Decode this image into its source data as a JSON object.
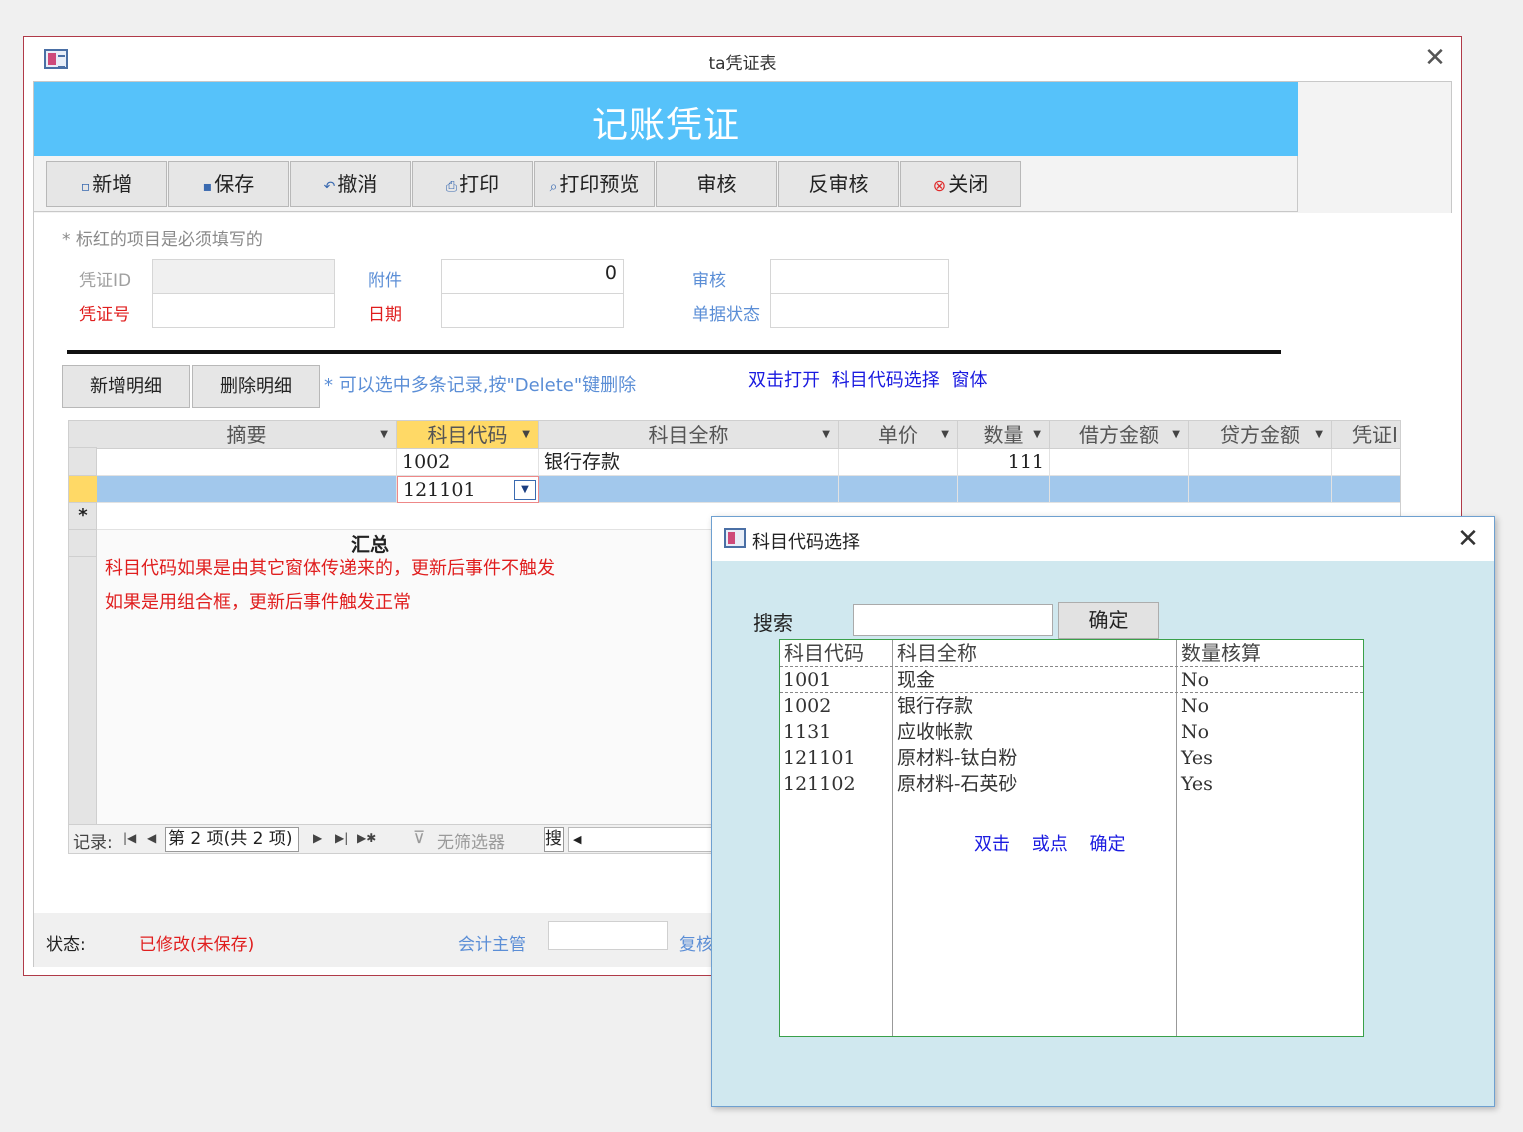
{
  "window": {
    "title": "ta凭证表"
  },
  "header": {
    "title": "记账凭证"
  },
  "toolbar": {
    "buttons": [
      {
        "label": "新增",
        "icon": "new-record-icon"
      },
      {
        "label": "保存",
        "icon": "save-disk-icon"
      },
      {
        "label": "撤消",
        "icon": "undo-arrow-icon"
      },
      {
        "label": "打印",
        "icon": "printer-icon"
      },
      {
        "label": "打印预览",
        "icon": "magnifier-icon"
      },
      {
        "label": "审核",
        "icon": ""
      },
      {
        "label": "反审核",
        "icon": ""
      },
      {
        "label": "关闭",
        "icon": "close-circle-icon"
      }
    ]
  },
  "form": {
    "required_note": "* 标红的项目是必须填写的",
    "voucher_id_label": "凭证ID",
    "voucher_no_label": "凭证号",
    "attachment_label": "附件",
    "attachment_value": "0",
    "date_label": "日期",
    "review_label": "审核",
    "doc_status_label": "单据状态"
  },
  "detail": {
    "add_button": "新增明细",
    "delete_button": "删除明细",
    "delete_note": "* 可以选中多条记录,按\"Delete\"键删除",
    "dblclick_note": "双击打开 科目代码选择 窗体"
  },
  "datasheet": {
    "columns": [
      "摘要",
      "科目代码",
      "科目全称",
      "单价",
      "数量",
      "借方金额",
      "贷方金额",
      "凭证I"
    ],
    "rows": [
      {
        "summary": "",
        "code": "1002",
        "name": "银行存款",
        "price": "",
        "qty": "111",
        "debit": "",
        "credit": ""
      },
      {
        "summary": "",
        "code": "121101",
        "name": "",
        "price": "",
        "qty": "",
        "debit": "",
        "credit": ""
      }
    ],
    "new_row_marker": "*",
    "summary_label": "汇总",
    "notes": [
      "科目代码如果是由其它窗体传递来的，更新后事件不触发",
      "如果是用组合框，更新后事件触发正常"
    ]
  },
  "navigation": {
    "record_label": "记录:",
    "record_position": "第 2 项(共 2 项)",
    "filter_label": "无筛选器",
    "search_label": "搜"
  },
  "status_bar": {
    "label": "状态:",
    "value": "已修改(未保存)",
    "accountant_label": "会计主管",
    "review_label": "复核"
  },
  "popup": {
    "title": "科目代码选择",
    "search_label": "搜索",
    "search_value": "",
    "confirm_label": "确定",
    "columns": [
      "科目代码",
      "科目全称",
      "数量核算"
    ],
    "rows": [
      [
        "1001",
        "现金",
        "No"
      ],
      [
        "1002",
        "银行存款",
        "No"
      ],
      [
        "1131",
        "应收帐款",
        "No"
      ],
      [
        "121101",
        "原材料-钛白粉",
        "Yes"
      ],
      [
        "121102",
        "原材料-石英砂",
        "Yes"
      ]
    ],
    "hint": "双击 或点 确定"
  },
  "colors": {
    "banner": "#56c2fa",
    "required_red": "#e01e1e",
    "label_blue": "#5b8ed6",
    "active_column": "#ffd966",
    "current_row": "#a2c8ec",
    "popup_bg": "#d0e8ef"
  }
}
